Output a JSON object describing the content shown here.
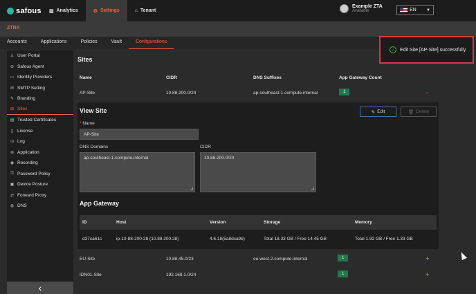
{
  "app": {
    "logo_text": "safous"
  },
  "topnav": [
    {
      "label": "Analytics",
      "icon": "analytics-icon"
    },
    {
      "label": "Settings",
      "icon": "gear-icon",
      "active": true
    },
    {
      "label": "Tenant",
      "icon": "tenant-icon"
    }
  ],
  "user": {
    "name": "Example ZTA",
    "status": "Available"
  },
  "language": {
    "selected": "EN"
  },
  "section": {
    "title": "ZTNA"
  },
  "subnav": [
    {
      "label": "Accounts"
    },
    {
      "label": "Applications"
    },
    {
      "label": "Policies"
    },
    {
      "label": "Vault"
    },
    {
      "label": "Configurations",
      "active": true
    }
  ],
  "sidebar": {
    "items": [
      {
        "label": "User Portal",
        "icon": "user-icon"
      },
      {
        "label": "Safous Agent",
        "icon": "agent-icon"
      },
      {
        "label": "Identity Providers",
        "icon": "id-card-icon"
      },
      {
        "label": "SMTP Setting",
        "icon": "mail-icon"
      },
      {
        "label": "Branding",
        "icon": "brush-icon"
      },
      {
        "label": "Sites",
        "icon": "sites-icon",
        "active": true
      },
      {
        "label": "Trusted Certificates",
        "icon": "certificate-icon"
      },
      {
        "label": "License",
        "icon": "license-icon"
      },
      {
        "label": "Log",
        "icon": "log-icon"
      },
      {
        "label": "Application",
        "icon": "app-icon"
      },
      {
        "label": "Recording",
        "icon": "recording-icon"
      },
      {
        "label": "Password Policy",
        "icon": "key-icon"
      },
      {
        "label": "Device Posture",
        "icon": "device-icon"
      },
      {
        "label": "Forward Proxy",
        "icon": "proxy-icon"
      },
      {
        "label": "DNS",
        "icon": "globe-icon"
      }
    ],
    "collapse_glyph": "‹"
  },
  "sites": {
    "title": "Sites",
    "columns": [
      "Name",
      "CIDR",
      "DNS Suffixes",
      "App Gateway Count"
    ],
    "rows": [
      {
        "name": "AP-Site",
        "cidr": "10.88.200.0/24",
        "dns": "ap-southeast-1.compute.internal",
        "count": "1",
        "action": "−"
      },
      {
        "name": "EU-Site",
        "cidr": "10.88.45.0/23",
        "dns": "eu-west-2.compute.internal",
        "count": "1",
        "action": "+"
      },
      {
        "name": "IDN01-Site",
        "cidr": "192.168.1.0/24",
        "dns": "",
        "count": "1",
        "action": "+"
      }
    ]
  },
  "view_site": {
    "title": "View Site",
    "edit_label": "Edit",
    "delete_label": "Delete",
    "name_label": "Name",
    "name_required": "*",
    "name_value": "AP-Site",
    "dns_label": "DNS Domains",
    "dns_value": "ap-southeast-1.compute.internal",
    "cidr_label": "CIDR",
    "cidr_value": "10.88.200.0/24"
  },
  "app_gateway": {
    "title": "App Gateway",
    "columns": [
      "ID",
      "Host",
      "Version",
      "Storage",
      "Memory"
    ],
    "rows": [
      {
        "id": "d37ca61c",
        "host": "ip-10-88-200-28 (10.88.200.28)",
        "version": "4.6.18(5a8dca9e)",
        "storage": "Total 18.33 GB / Free 14.45 GB",
        "memory": "Total 1.92 GB / Free 1.33 GB"
      }
    ]
  },
  "toast": {
    "message": "Edit Site [AP-Site] successfully",
    "icon": "check-circle-icon"
  },
  "colors": {
    "accent": "#ff5a3c",
    "badge": "#1f7a4d",
    "toast_border": "#e3343d",
    "edit_border": "#3f72b8"
  }
}
